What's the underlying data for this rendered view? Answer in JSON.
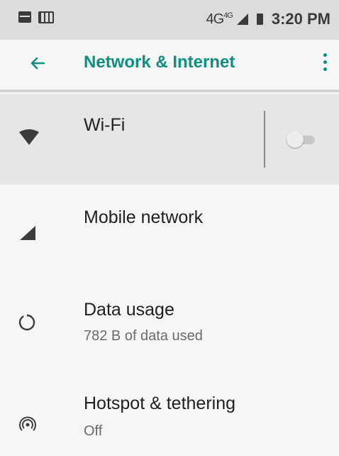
{
  "status_bar": {
    "network_label": "4G",
    "network_sup": "4G",
    "time": "3:20 PM"
  },
  "app_bar": {
    "title": "Network & Internet",
    "back_icon": "arrow-left-icon",
    "menu_icon": "overflow-menu-icon"
  },
  "colors": {
    "accent": "#0f8f80",
    "status_bar_bg": "#dcdcdc",
    "highlight_row_bg": "#e6e6e6"
  },
  "items": [
    {
      "title": "Wi-Fi",
      "icon": "wifi-icon",
      "toggle": "off"
    },
    {
      "title": "Mobile network",
      "icon": "signal-icon"
    },
    {
      "title": "Data usage",
      "subtitle": "782 B of data used",
      "icon": "data-usage-icon"
    },
    {
      "title": "Hotspot & tethering",
      "subtitle": "Off",
      "icon": "hotspot-icon"
    }
  ]
}
